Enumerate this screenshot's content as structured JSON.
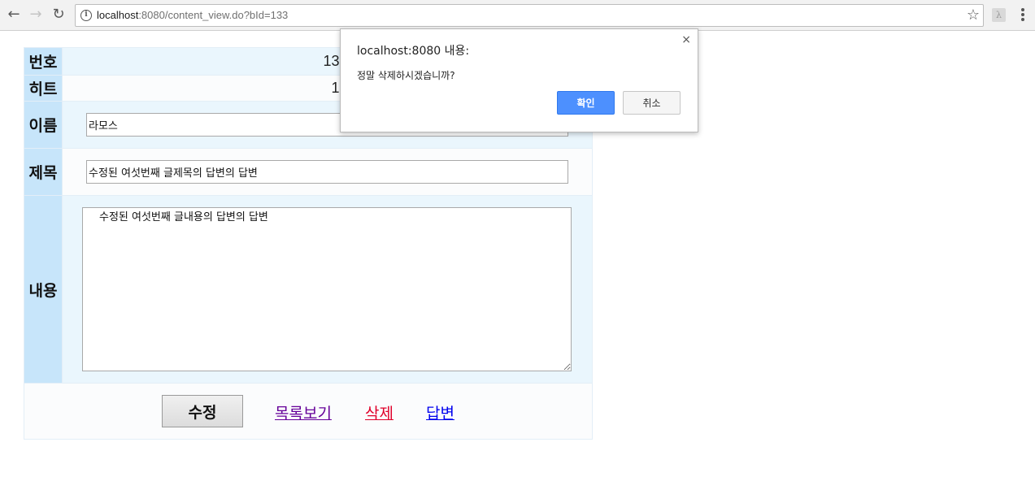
{
  "browser": {
    "url_host": "localhost",
    "url_path": ":8080/content_view.do?bId=133"
  },
  "board": {
    "number_label": "번호",
    "number_value": "133",
    "hit_label": "히트",
    "hit_value": "1",
    "name_label": "이름",
    "name_value": "라모스",
    "title_label": "제목",
    "title_value": "수정된 여섯번째 글제목의 답변의 답변",
    "content_label": "내용",
    "content_value": "수정된 여섯번째 글내용의 답변의 답변"
  },
  "actions": {
    "edit_label": "수정",
    "list_label": "목록보기",
    "delete_label": "삭제",
    "reply_label": "답변"
  },
  "dialog": {
    "title": "localhost:8080 내용:",
    "message": "정말 삭제하시겠습니까?",
    "ok_label": "확인",
    "cancel_label": "취소",
    "close_glyph": "×"
  },
  "colors": {
    "header_cell": "#c7e5fa",
    "value_cell": "#eaf6fd",
    "link_visited": "#660099",
    "link_delete": "#e0002a",
    "link_reply": "#0000ee",
    "ok_button": "#4d90fe"
  }
}
